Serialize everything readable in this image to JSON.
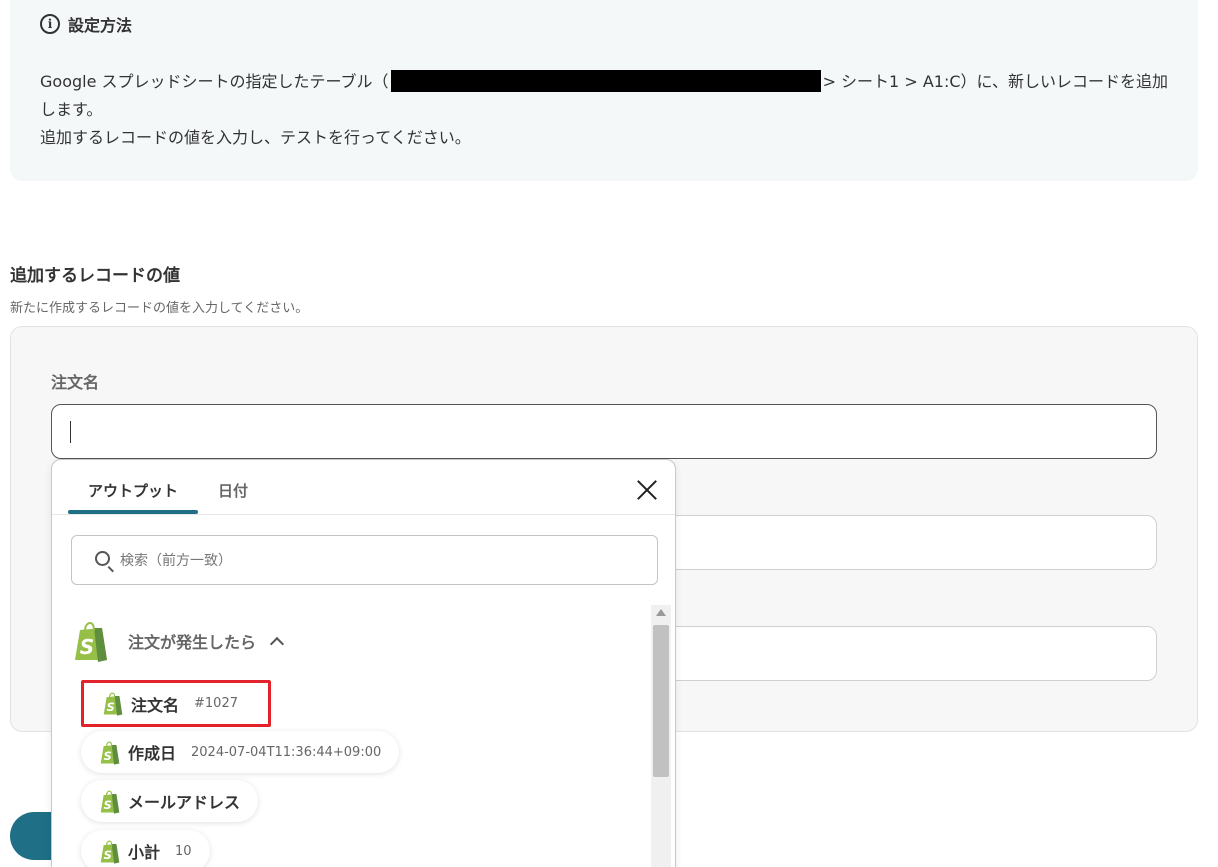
{
  "info": {
    "title": "設定方法",
    "text_before_redaction": "Google スプレッドシートの指定したテーブル（",
    "text_after_redaction": "> シート1 > A1:C）に、新しいレコードを追加します。",
    "text_line2": "追加するレコードの値を入力し、テストを行ってください。"
  },
  "section": {
    "title": "追加するレコードの値",
    "description": "新たに作成するレコードの値を入力してください。"
  },
  "fields": {
    "order_name_label": "注文名"
  },
  "popup": {
    "tabs": [
      {
        "label": "アウトプット",
        "active": true
      },
      {
        "label": "日付",
        "active": false
      }
    ],
    "search_placeholder": "検索（前方一致）",
    "group": {
      "label": "注文が発生したら",
      "icon": "shopify-icon"
    },
    "items": [
      {
        "label": "注文名",
        "value": "#1027",
        "highlighted": true
      },
      {
        "label": "作成日",
        "value": "2024-07-04T11:36:44+09:00",
        "highlighted": false
      },
      {
        "label": "メールアドレス",
        "value": "",
        "highlighted": false
      },
      {
        "label": "小計",
        "value": "10",
        "highlighted": false
      }
    ]
  },
  "colors": {
    "accent": "#1f6f86",
    "shopify_green": "#95bf47",
    "highlight": "#e3232b"
  }
}
